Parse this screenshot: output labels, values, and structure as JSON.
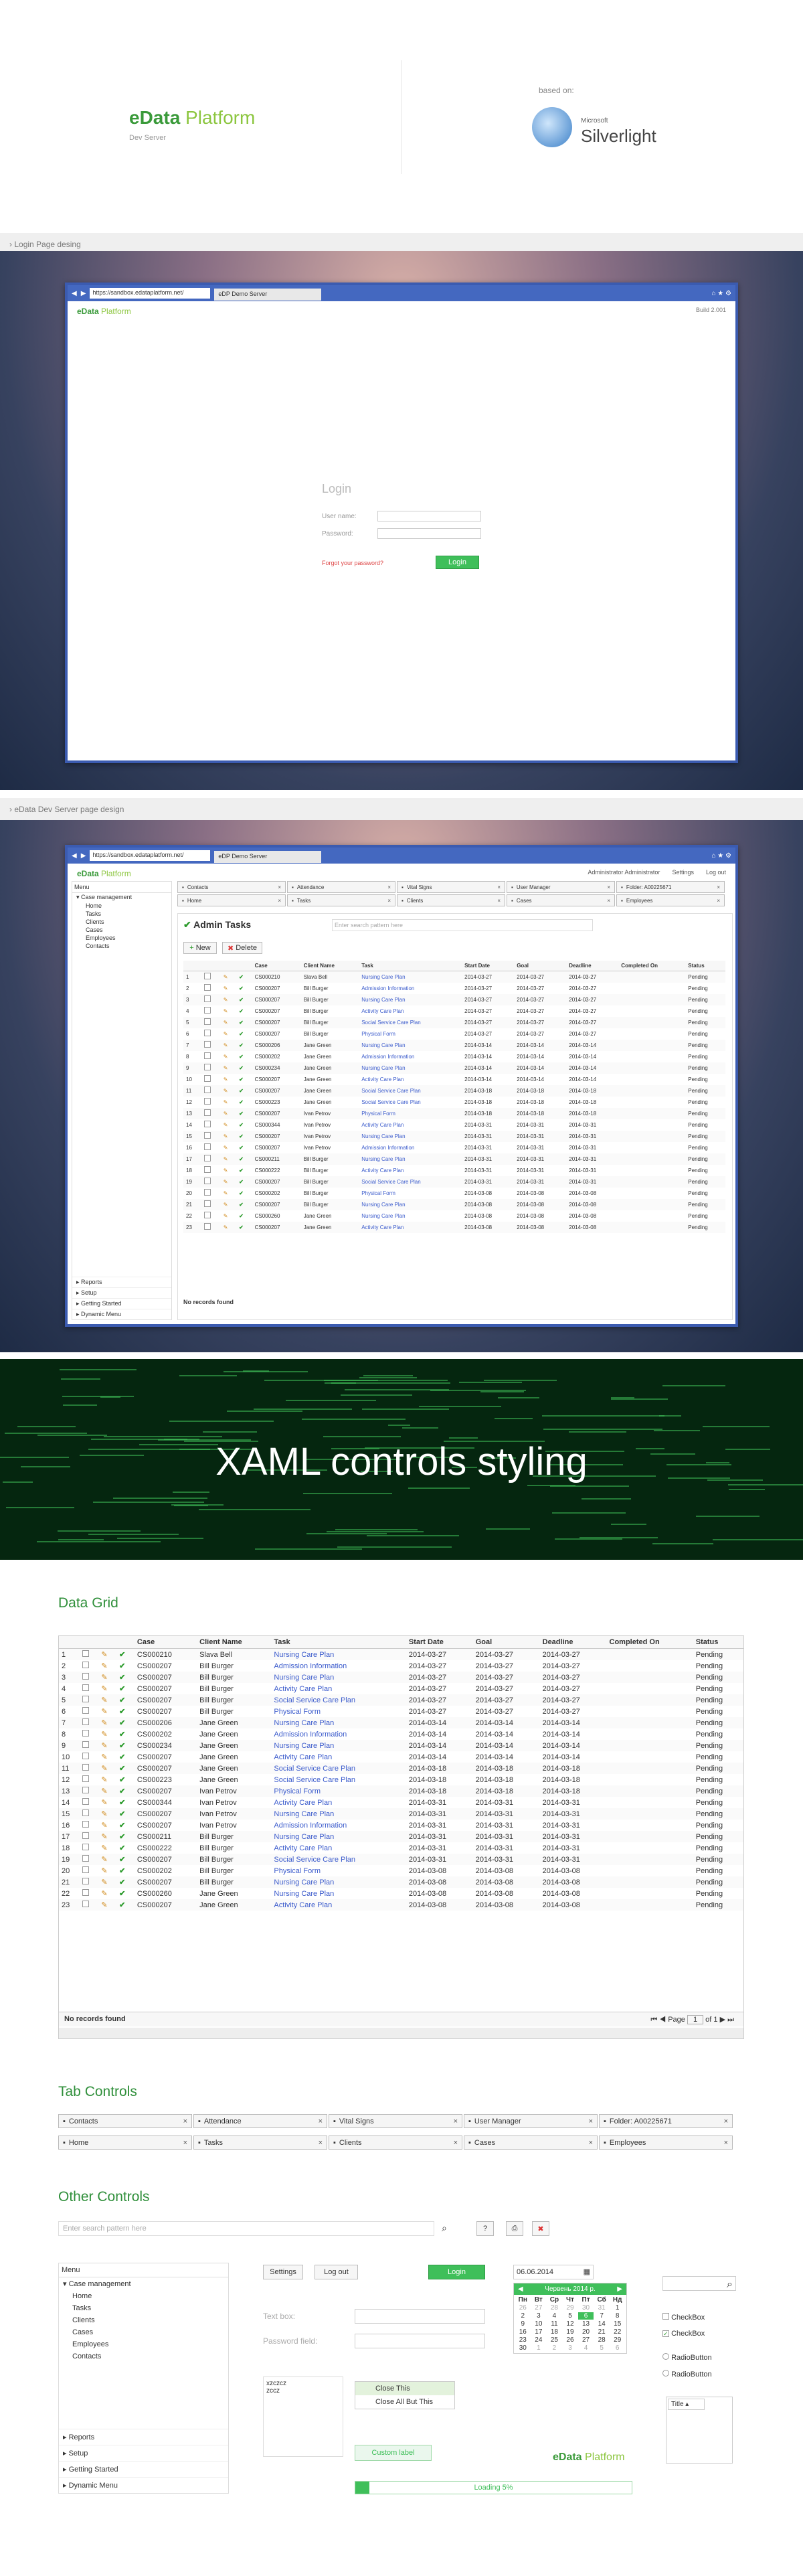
{
  "hero": {
    "logo_edata": "eData",
    "logo_platform": "Platform",
    "subtitle": "Dev Server",
    "based_on": "based on:",
    "ms": "Microsoft",
    "silverlight": "Silverlight"
  },
  "section1": {
    "label": "Login Page desing"
  },
  "browser": {
    "url": "https://sandbox.edataplatform.net/",
    "tab_title": "eDP Demo Server",
    "build": "Build 2.001"
  },
  "login": {
    "title": "Login",
    "username_label": "User name:",
    "password_label": "Password:",
    "forgot": "Forgot your password?",
    "button": "Login"
  },
  "section2": {
    "label": "eData Dev Server page design"
  },
  "app": {
    "user": "Administrator Administrator",
    "settings": "Settings",
    "logout": "Log out",
    "menu_label": "Menu",
    "menu_items": [
      "Case management",
      "Home",
      "Tasks",
      "Clients",
      "Cases",
      "Employees",
      "Contacts"
    ],
    "bottom_menu": [
      "Reports",
      "Setup",
      "Getting Started",
      "Dynamic Menu"
    ],
    "page_title": "Admin Tasks",
    "search_placeholder": "Enter search pattern here",
    "new_btn": "New",
    "delete_btn": "Delete"
  },
  "tabs_row1": [
    "Contacts",
    "Attendance",
    "Vital Signs",
    "User Manager",
    "Folder: A00225671"
  ],
  "tabs_row2": [
    "Home",
    "Tasks",
    "Clients",
    "Cases",
    "Employees"
  ],
  "grid": {
    "headers": [
      "",
      "",
      "",
      "",
      "Case",
      "Client Name",
      "Task",
      "Start Date",
      "Goal",
      "Deadline",
      "Completed On",
      "Status"
    ],
    "rows": [
      [
        "1",
        "CS000210",
        "Slava Bell",
        "Nursing Care Plan",
        "2014-03-27",
        "2014-03-27",
        "2014-03-27",
        "",
        "Pending"
      ],
      [
        "2",
        "CS000207",
        "Bill Burger",
        "Admission Information",
        "2014-03-27",
        "2014-03-27",
        "2014-03-27",
        "",
        "Pending"
      ],
      [
        "3",
        "CS000207",
        "Bill Burger",
        "Nursing Care Plan",
        "2014-03-27",
        "2014-03-27",
        "2014-03-27",
        "",
        "Pending"
      ],
      [
        "4",
        "CS000207",
        "Bill Burger",
        "Activity Care Plan",
        "2014-03-27",
        "2014-03-27",
        "2014-03-27",
        "",
        "Pending"
      ],
      [
        "5",
        "CS000207",
        "Bill Burger",
        "Social Service Care Plan",
        "2014-03-27",
        "2014-03-27",
        "2014-03-27",
        "",
        "Pending"
      ],
      [
        "6",
        "CS000207",
        "Bill Burger",
        "Physical Form",
        "2014-03-27",
        "2014-03-27",
        "2014-03-27",
        "",
        "Pending"
      ],
      [
        "7",
        "CS000206",
        "Jane Green",
        "Nursing Care Plan",
        "2014-03-14",
        "2014-03-14",
        "2014-03-14",
        "",
        "Pending"
      ],
      [
        "8",
        "CS000202",
        "Jane Green",
        "Admission Information",
        "2014-03-14",
        "2014-03-14",
        "2014-03-14",
        "",
        "Pending"
      ],
      [
        "9",
        "CS000234",
        "Jane Green",
        "Nursing Care Plan",
        "2014-03-14",
        "2014-03-14",
        "2014-03-14",
        "",
        "Pending"
      ],
      [
        "10",
        "CS000207",
        "Jane Green",
        "Activity Care Plan",
        "2014-03-14",
        "2014-03-14",
        "2014-03-14",
        "",
        "Pending"
      ],
      [
        "11",
        "CS000207",
        "Jane Green",
        "Social Service Care Plan",
        "2014-03-18",
        "2014-03-18",
        "2014-03-18",
        "",
        "Pending"
      ],
      [
        "12",
        "CS000223",
        "Jane Green",
        "Social Service Care Plan",
        "2014-03-18",
        "2014-03-18",
        "2014-03-18",
        "",
        "Pending"
      ],
      [
        "13",
        "CS000207",
        "Ivan Petrov",
        "Physical Form",
        "2014-03-18",
        "2014-03-18",
        "2014-03-18",
        "",
        "Pending"
      ],
      [
        "14",
        "CS000344",
        "Ivan Petrov",
        "Activity Care Plan",
        "2014-03-31",
        "2014-03-31",
        "2014-03-31",
        "",
        "Pending"
      ],
      [
        "15",
        "CS000207",
        "Ivan Petrov",
        "Nursing Care Plan",
        "2014-03-31",
        "2014-03-31",
        "2014-03-31",
        "",
        "Pending"
      ],
      [
        "16",
        "CS000207",
        "Ivan Petrov",
        "Admission Information",
        "2014-03-31",
        "2014-03-31",
        "2014-03-31",
        "",
        "Pending"
      ],
      [
        "17",
        "CS000211",
        "Bill Burger",
        "Nursing Care Plan",
        "2014-03-31",
        "2014-03-31",
        "2014-03-31",
        "",
        "Pending"
      ],
      [
        "18",
        "CS000222",
        "Bill Burger",
        "Activity Care Plan",
        "2014-03-31",
        "2014-03-31",
        "2014-03-31",
        "",
        "Pending"
      ],
      [
        "19",
        "CS000207",
        "Bill Burger",
        "Social Service Care Plan",
        "2014-03-31",
        "2014-03-31",
        "2014-03-31",
        "",
        "Pending"
      ],
      [
        "20",
        "CS000202",
        "Bill Burger",
        "Physical Form",
        "2014-03-08",
        "2014-03-08",
        "2014-03-08",
        "",
        "Pending"
      ],
      [
        "21",
        "CS000207",
        "Bill Burger",
        "Nursing Care Plan",
        "2014-03-08",
        "2014-03-08",
        "2014-03-08",
        "",
        "Pending"
      ],
      [
        "22",
        "CS000260",
        "Jane Green",
        "Nursing Care Plan",
        "2014-03-08",
        "2014-03-08",
        "2014-03-08",
        "",
        "Pending"
      ],
      [
        "23",
        "CS000207",
        "Jane Green",
        "Activity Care Plan",
        "2014-03-08",
        "2014-03-08",
        "2014-03-08",
        "",
        "Pending"
      ]
    ],
    "footer": "No records found",
    "page_label": "Page",
    "page_value": "1",
    "page_of": "of 1"
  },
  "xaml_title": "XAML controls styling",
  "headings": {
    "data_grid": "Data Grid",
    "tab_controls": "Tab Controls",
    "other_controls": "Other Controls"
  },
  "other": {
    "search_placeholder": "Enter search pattern here",
    "settings": "Settings",
    "logout": "Log out",
    "login": "Login",
    "textbox_label": "Text box:",
    "password_label": "Password field:",
    "list_items": [
      "xzczcz",
      "zccz"
    ],
    "context_items": [
      "Close This",
      "Close All But This"
    ],
    "custom_label": "Custom label",
    "loading": "Loading 5%",
    "loading_value": 0.05,
    "date_value": "06.06.2014",
    "calendar_title": "Червень 2014 р.",
    "week_days": [
      "Пн",
      "Вт",
      "Ср",
      "Чт",
      "Пт",
      "Сб",
      "Нд"
    ],
    "calendar_days": [
      "26",
      "27",
      "28",
      "29",
      "30",
      "31",
      "1",
      "2",
      "3",
      "4",
      "5",
      "6",
      "7",
      "8",
      "9",
      "10",
      "11",
      "12",
      "13",
      "14",
      "15",
      "16",
      "17",
      "18",
      "19",
      "20",
      "21",
      "22",
      "23",
      "24",
      "25",
      "26",
      "27",
      "28",
      "29",
      "30",
      "1",
      "2",
      "3",
      "4",
      "5",
      "6"
    ],
    "checkbox1": "CheckBox",
    "checkbox2": "CheckBox",
    "radio1": "RadioButton",
    "radio2": "RadioButton",
    "dropdown_title": "Title"
  },
  "colors": {
    "accent": "#3fbf5a",
    "brand_dark": "#2f8f3a",
    "link": "#3b5bcc"
  }
}
